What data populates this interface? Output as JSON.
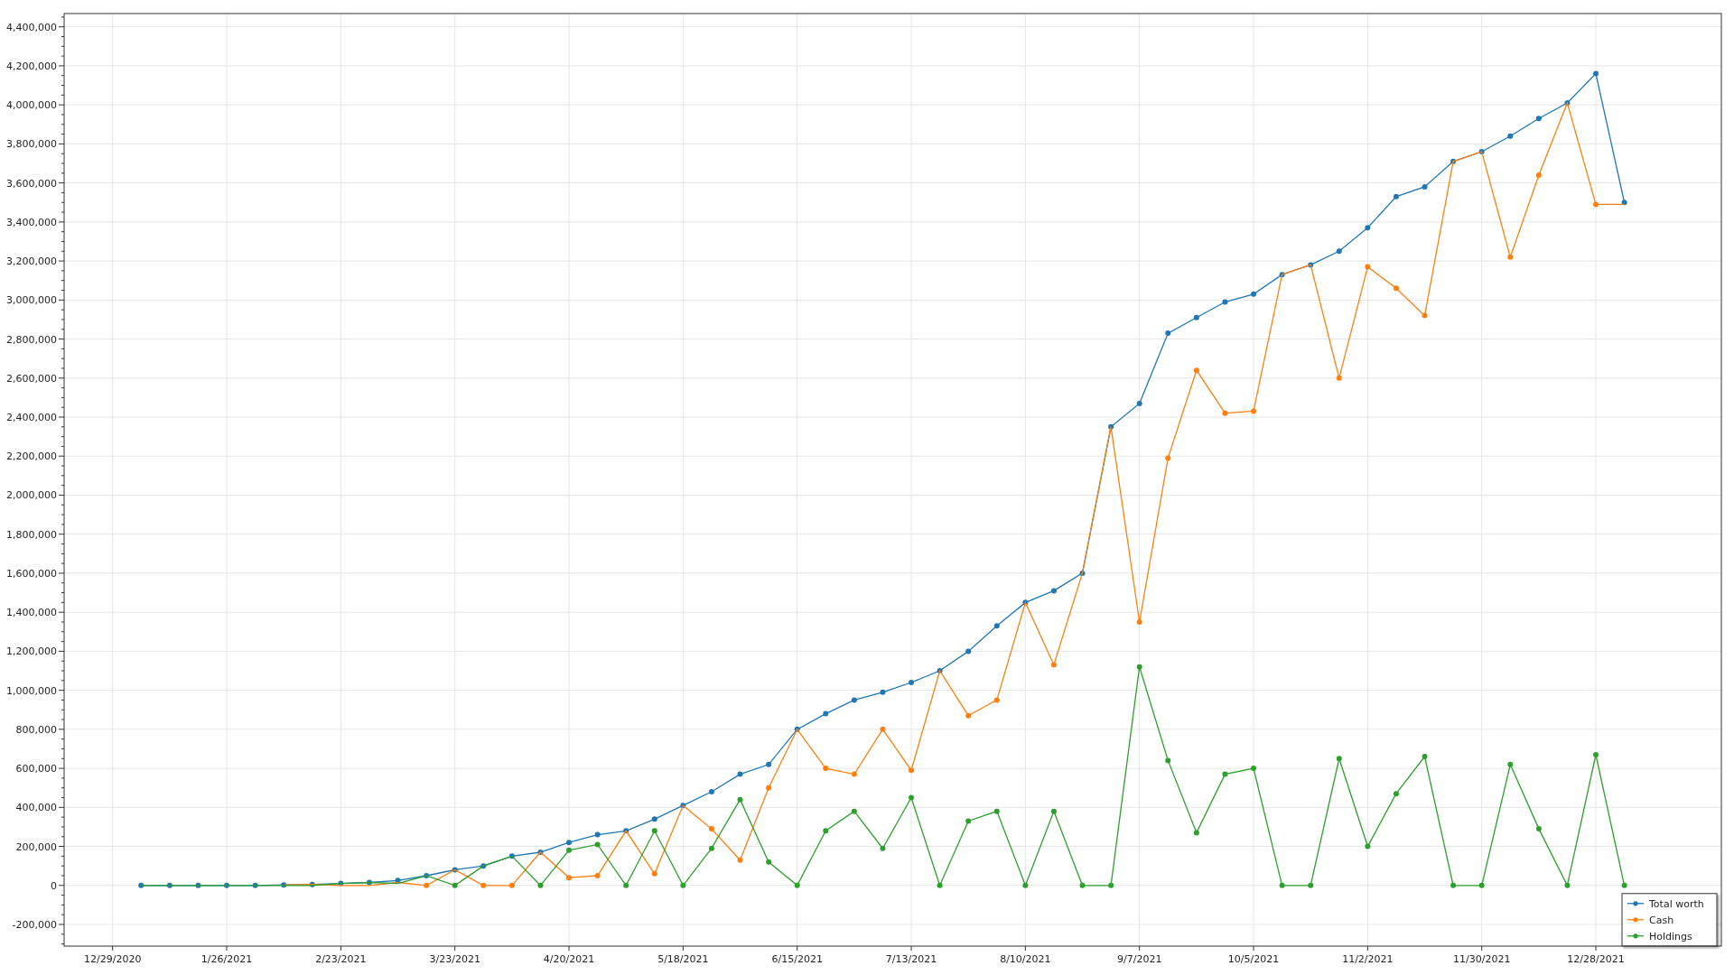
{
  "chart": {
    "chart_data": {
      "type": "line",
      "grid": true,
      "legend": true,
      "categories": [
        "12/29/2020",
        null,
        null,
        null,
        "1/26/2021",
        null,
        null,
        null,
        "2/23/2021",
        null,
        null,
        null,
        "3/23/2021",
        null,
        null,
        null,
        "4/20/2021",
        null,
        null,
        null,
        "5/18/2021",
        null,
        null,
        null,
        "6/15/2021",
        null,
        null,
        null,
        "7/13/2021",
        null,
        null,
        null,
        "8/10/2021",
        null,
        null,
        null,
        "9/7/2021",
        null,
        null,
        null,
        "10/5/2021",
        null,
        null,
        null,
        "11/2/2021",
        null,
        null,
        null,
        "11/30/2021",
        null,
        null,
        null,
        "12/28/2021",
        null
      ],
      "ylim": [
        -311000,
        4468000
      ],
      "yticks": [
        {
          "value": -200000,
          "label": "-200,000"
        },
        {
          "value": 0,
          "label": "0"
        },
        {
          "value": 200000,
          "label": "200,000"
        },
        {
          "value": 400000,
          "label": "400,000"
        },
        {
          "value": 600000,
          "label": "600,000"
        },
        {
          "value": 800000,
          "label": "800,000"
        },
        {
          "value": 1000000,
          "label": "1,000,000"
        },
        {
          "value": 1200000,
          "label": "1,200,000"
        },
        {
          "value": 1400000,
          "label": "1,400,000"
        },
        {
          "value": 1600000,
          "label": "1,600,000"
        },
        {
          "value": 1800000,
          "label": "1,800,000"
        },
        {
          "value": 2000000,
          "label": "2,000,000"
        },
        {
          "value": 2200000,
          "label": "2,200,000"
        },
        {
          "value": 2400000,
          "label": "2,400,000"
        },
        {
          "value": 2600000,
          "label": "2,600,000"
        },
        {
          "value": 2800000,
          "label": "2,800,000"
        },
        {
          "value": 3000000,
          "label": "3,000,000"
        },
        {
          "value": 3200000,
          "label": "3,200,000"
        },
        {
          "value": 3400000,
          "label": "3,400,000"
        },
        {
          "value": 3600000,
          "label": "3,600,000"
        },
        {
          "value": 3800000,
          "label": "3,800,000"
        },
        {
          "value": 4000000,
          "label": "4,000,000"
        },
        {
          "value": 4200000,
          "label": "4,200,000"
        },
        {
          "value": 4400000,
          "label": "4,400,000"
        }
      ],
      "series": [
        {
          "name": "Total worth",
          "color": "#1f77b4",
          "marker": "circle",
          "values": [
            null,
            0,
            0,
            0,
            0,
            0,
            3000,
            5000,
            10000,
            15000,
            25000,
            50000,
            80000,
            100000,
            150000,
            170000,
            220000,
            260000,
            280000,
            340000,
            410000,
            480000,
            570000,
            620000,
            800000,
            880000,
            950000,
            990000,
            1040000,
            1100000,
            1200000,
            1330000,
            1450000,
            1510000,
            1600000,
            2350000,
            2470000,
            2830000,
            2910000,
            2990000,
            3030000,
            3130000,
            3180000,
            3250000,
            3370000,
            3530000,
            3580000,
            3710000,
            3760000,
            3840000,
            3930000,
            4010000,
            4160000,
            3500000
          ]
        },
        {
          "name": "Cash",
          "color": "#ff7f0e",
          "marker": "circle",
          "values": [
            null,
            null,
            null,
            null,
            null,
            null,
            3000,
            5000,
            0,
            0,
            15000,
            0,
            80000,
            0,
            0,
            170000,
            40000,
            50000,
            280000,
            60000,
            410000,
            290000,
            130000,
            500000,
            800000,
            600000,
            570000,
            800000,
            590000,
            1100000,
            870000,
            950000,
            1450000,
            1130000,
            1600000,
            2350000,
            1350000,
            2190000,
            2640000,
            2420000,
            2430000,
            3130000,
            3180000,
            2600000,
            3170000,
            3060000,
            2920000,
            3710000,
            3760000,
            3220000,
            3640000,
            4010000,
            3490000,
            3490000
          ]
        },
        {
          "name": "Holdings",
          "color": "#2ca02c",
          "marker": "circle",
          "values": [
            null,
            0,
            0,
            0,
            0,
            0,
            0,
            0,
            10000,
            15000,
            10000,
            50000,
            0,
            100000,
            150000,
            0,
            180000,
            210000,
            0,
            280000,
            0,
            190000,
            440000,
            120000,
            0,
            280000,
            380000,
            190000,
            450000,
            0,
            330000,
            380000,
            0,
            380000,
            0,
            0,
            1120000,
            640000,
            270000,
            570000,
            600000,
            0,
            0,
            650000,
            200000,
            470000,
            660000,
            0,
            0,
            620000,
            290000,
            0,
            670000,
            0
          ]
        }
      ]
    }
  }
}
